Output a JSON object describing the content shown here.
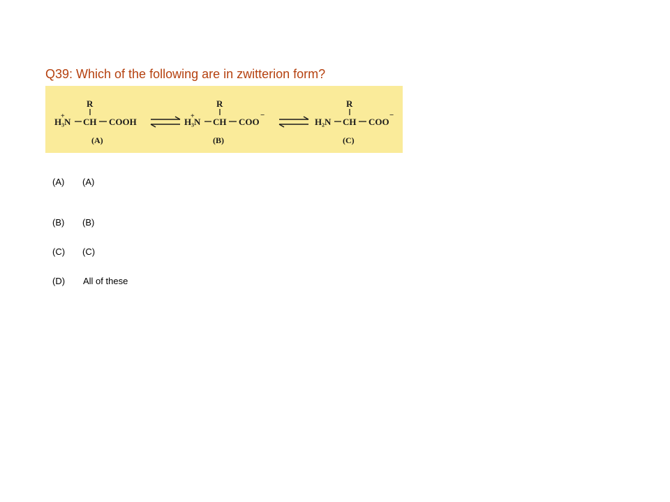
{
  "question": "Q39: Which of the following are in zwitterion form?",
  "figure": {
    "forms": [
      {
        "side": "R",
        "left": "H₃N",
        "charge_left": "+",
        "center": "CH",
        "right": "COOH",
        "charge_right": "",
        "label": "(A)"
      },
      {
        "side": "R",
        "left": "H₃N",
        "charge_left": "+",
        "center": "CH",
        "right": "COO",
        "charge_right": "−",
        "label": "(B)"
      },
      {
        "side": "R",
        "left": "H₂N",
        "charge_left": "",
        "center": "CH",
        "right": "COO",
        "charge_right": "−",
        "label": "(C)"
      }
    ]
  },
  "options": [
    {
      "letter": "(A)",
      "text": "(A)"
    },
    {
      "letter": "(B)",
      "text": "(B)"
    },
    {
      "letter": "(C)",
      "text": "(C)"
    },
    {
      "letter": "(D)",
      "text": "All of these"
    }
  ]
}
